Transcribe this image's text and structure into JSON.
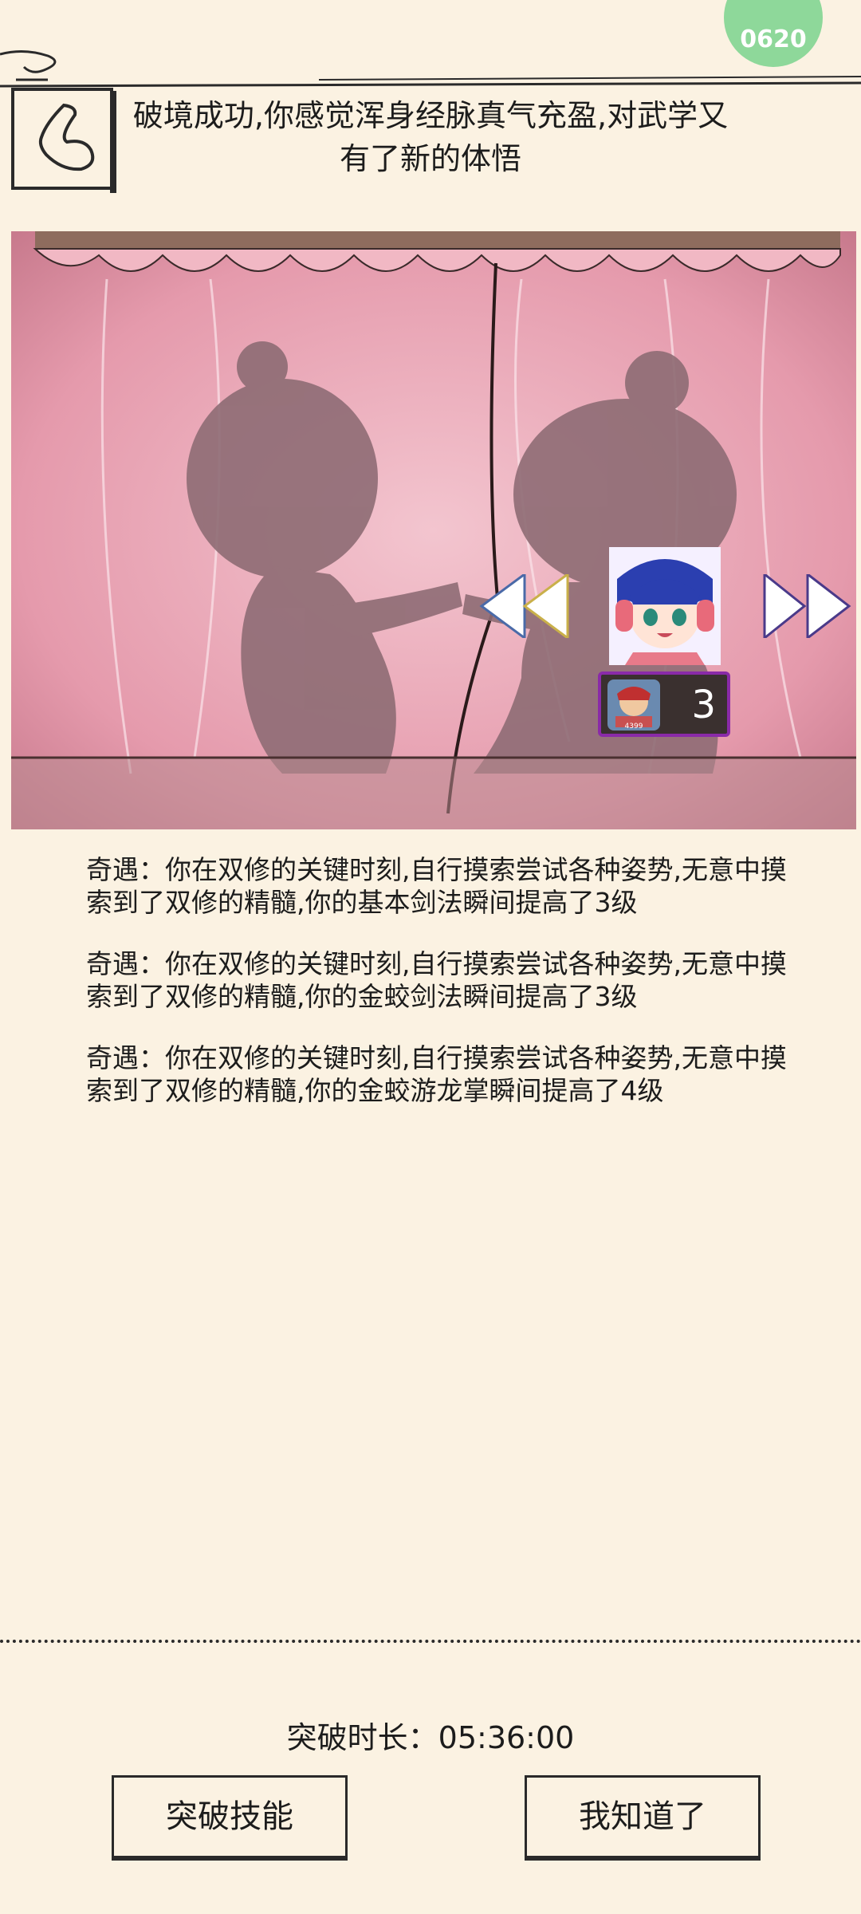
{
  "header": {
    "message": "破境成功,你感觉浑身经脉真气充盈,对武学又有了新的体悟",
    "badge_text": "0620"
  },
  "scene": {
    "counter_value": "3"
  },
  "messages": [
    "奇遇：你在双修的关键时刻,自行摸索尝试各种姿势,无意中摸索到了双修的精髓,你的基本剑法瞬间提高了3级",
    "奇遇：你在双修的关键时刻,自行摸索尝试各种姿势,无意中摸索到了双修的精髓,你的金蛟剑法瞬间提高了3级",
    "奇遇：你在双修的关键时刻,自行摸索尝试各种姿势,无意中摸索到了双修的精髓,你的金蛟游龙掌瞬间提高了4级"
  ],
  "footer": {
    "duration_label": "突破时长：",
    "duration_value": "05:36:00",
    "skill_button": "突破技能",
    "ok_button": "我知道了"
  },
  "colors": {
    "background": "#fbf2e2",
    "curtain": "#e8a6b4",
    "shadow": "#8e6c74",
    "badge": "#8ed89a"
  }
}
